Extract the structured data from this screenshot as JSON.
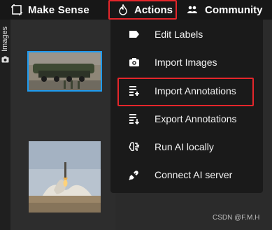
{
  "topbar": {
    "brand": "Make Sense",
    "menu": [
      {
        "label": "Actions",
        "icon": "flame-icon"
      },
      {
        "label": "Community",
        "icon": "people-icon"
      }
    ]
  },
  "sidebar": {
    "tab_label": "Images",
    "tab_icon": "camera-icon"
  },
  "gallery": {
    "thumbnails": [
      {
        "selected": true
      },
      {
        "selected": false
      }
    ]
  },
  "dropdown": {
    "items": [
      {
        "label": "Edit Labels",
        "icon": "label-tag-icon"
      },
      {
        "label": "Import Images",
        "icon": "camera-icon"
      },
      {
        "label": "Import Annotations",
        "icon": "import-annotations-icon",
        "highlighted": true
      },
      {
        "label": "Export Annotations",
        "icon": "export-annotations-icon"
      },
      {
        "label": "Run AI locally",
        "icon": "brain-icon"
      },
      {
        "label": "Connect AI server",
        "icon": "plug-icon"
      }
    ]
  },
  "watermark": "CSDN @F.M.H",
  "colors": {
    "highlight": "#e5262b",
    "selection": "#1e9bf0",
    "menu_bg": "#1a1a1a",
    "topbar_bg": "#171717"
  }
}
